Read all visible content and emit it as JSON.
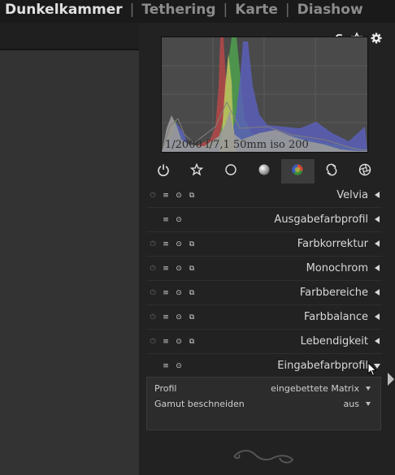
{
  "topbar": {
    "views": [
      {
        "label": "Dunkelkammer",
        "active": true
      },
      {
        "label": "Tethering",
        "active": false
      },
      {
        "label": "Karte",
        "active": false
      },
      {
        "label": "Diashow",
        "active": false
      }
    ],
    "separator": "|"
  },
  "quickbar": {
    "grouping_label": "G",
    "icons": [
      "star-icon",
      "gear-icon"
    ]
  },
  "histogram": {
    "exif": "1/2000 f/7,1 50mm iso 200"
  },
  "module_groups": {
    "icons": [
      "power-icon",
      "star-icon",
      "circle-icon",
      "sphere-icon",
      "color-icon",
      "correct-icon",
      "effect-icon"
    ],
    "active_index": 4
  },
  "modules": [
    {
      "name": "Velvia",
      "has_power": true,
      "expanded": false
    },
    {
      "name": "Ausgabefarbprofil",
      "has_power": false,
      "expanded": false
    },
    {
      "name": "Farbkorrektur",
      "has_power": true,
      "expanded": false
    },
    {
      "name": "Monochrom",
      "has_power": true,
      "expanded": false
    },
    {
      "name": "Farbbereiche",
      "has_power": true,
      "expanded": false
    },
    {
      "name": "Farbbalance",
      "has_power": true,
      "expanded": false
    },
    {
      "name": "Lebendigkeit",
      "has_power": true,
      "expanded": false
    },
    {
      "name": "Eingabefarbprofil",
      "has_power": false,
      "expanded": true
    }
  ],
  "expanded_params": {
    "profile_label": "Profil",
    "profile_value": "eingebettete Matrix",
    "gamut_label": "Gamut beschneiden",
    "gamut_value": "aus"
  }
}
